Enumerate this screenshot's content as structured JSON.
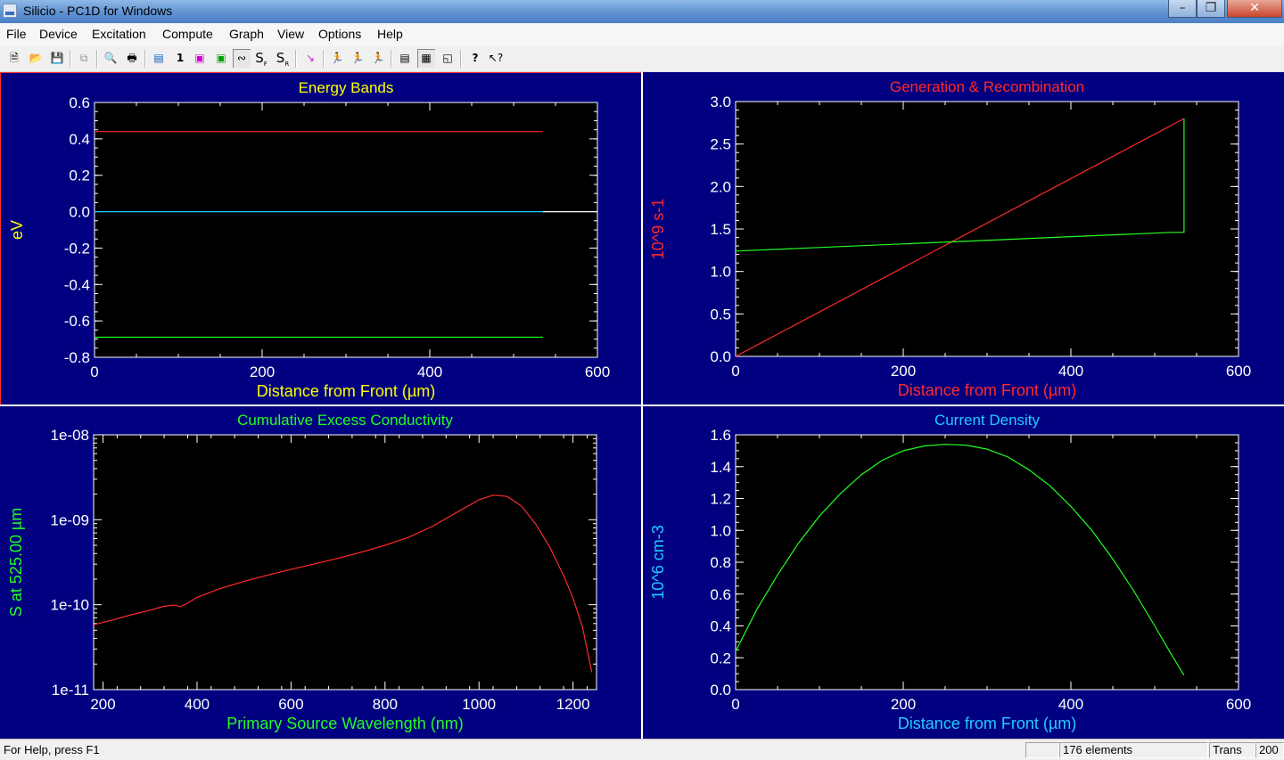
{
  "window": {
    "title": "Silicio - PC1D for Windows"
  },
  "menu": [
    "File",
    "Device",
    "Excitation",
    "Compute",
    "Graph",
    "View",
    "Options",
    "Help"
  ],
  "toolbar": {
    "sf_label": "S",
    "sf_sub": "F",
    "sr_label": "S",
    "sr_sub": "R",
    "one_label": "1",
    "help_label": "?"
  },
  "status": {
    "help_text": "For Help, press F1",
    "elements": "176 elements",
    "mode": "Trans",
    "value": "200"
  },
  "colors": {
    "panel_bg": "#000080",
    "plot_bg": "#000000",
    "yellow": "#ffff00",
    "red": "#ff2a2a",
    "green": "#22ff22",
    "cyan": "#22ccff"
  },
  "panels": [
    {
      "id": "energy-bands",
      "title": "Energy Bands",
      "title_color": "#ffff00",
      "xlabel": "Distance from Front (µm)",
      "xlabel_color": "#ffff00",
      "ylabel": "eV",
      "ylabel_color": "#ffff00",
      "xlim": [
        0,
        600
      ],
      "ylim": [
        -0.8,
        0.6
      ],
      "log": false,
      "xticks": [
        "0",
        "200",
        "400",
        "600"
      ],
      "xtick_values": [
        0,
        200,
        400,
        600
      ],
      "yticks": [
        "0.6",
        "0.4",
        "0.2",
        "0.0",
        "-0.2",
        "-0.4",
        "-0.6",
        "-0.8"
      ],
      "ytick_values": [
        0.6,
        0.4,
        0.2,
        0.0,
        -0.2,
        -0.4,
        -0.6,
        -0.8
      ],
      "xminor": 50,
      "yminor": 0.05,
      "series": [
        {
          "color": "#ff2a2a",
          "points": [
            [
              0,
              0.44
            ],
            [
              535,
              0.44
            ]
          ]
        },
        {
          "color": "#22ccff",
          "points": [
            [
              0,
              0.0
            ],
            [
              535,
              0.0
            ]
          ]
        },
        {
          "color": "#ffffff",
          "points": [
            [
              535,
              0.0
            ],
            [
              600,
              0.0
            ]
          ]
        },
        {
          "color": "#22ff22",
          "points": [
            [
              0,
              -0.69
            ],
            [
              535,
              -0.69
            ]
          ]
        }
      ]
    },
    {
      "id": "generation-recombination",
      "title": "Generation & Recombination",
      "title_color": "#ff2a2a",
      "xlabel": "Distance from Front (µm)",
      "xlabel_color": "#ff2a2a",
      "ylabel": "10^9  s-1",
      "ylabel_color": "#ff2a2a",
      "xlim": [
        0,
        600
      ],
      "ylim": [
        0,
        3.0
      ],
      "log": false,
      "xticks": [
        "0",
        "200",
        "400",
        "600"
      ],
      "xtick_values": [
        0,
        200,
        400,
        600
      ],
      "yticks": [
        "3.0",
        "2.5",
        "2.0",
        "1.5",
        "1.0",
        "0.5",
        "0.0"
      ],
      "ytick_values": [
        3.0,
        2.5,
        2.0,
        1.5,
        1.0,
        0.5,
        0.0
      ],
      "xminor": 50,
      "yminor": 0.1,
      "series": [
        {
          "color": "#ff2a2a",
          "points": [
            [
              0,
              0.0
            ],
            [
              535,
              2.8
            ]
          ]
        },
        {
          "color": "#22ff22",
          "points": [
            [
              0,
              1.24
            ],
            [
              520,
              1.46
            ],
            [
              535,
              1.46
            ],
            [
              535,
              2.8
            ]
          ]
        }
      ]
    },
    {
      "id": "cumulative-excess-conductivity",
      "title": "Cumulative Excess Conductivity",
      "title_color": "#22ff22",
      "xlabel": "Primary Source Wavelength (nm)",
      "xlabel_color": "#22ff22",
      "ylabel": "S at 525.00 µm",
      "ylabel_color": "#22ff22",
      "xlim": [
        180,
        1250
      ],
      "ylim": [
        1e-11,
        1e-08
      ],
      "log": true,
      "xticks": [
        "200",
        "400",
        "600",
        "800",
        "1000",
        "1200"
      ],
      "xtick_values": [
        200,
        400,
        600,
        800,
        1000,
        1200
      ],
      "yticks": [
        "1e-08",
        "1e-09",
        "1e-10",
        "1e-11"
      ],
      "ytick_values": [
        1e-08,
        1e-09,
        1e-10,
        1e-11
      ],
      "xminor": 50,
      "yminor": 0,
      "series": [
        {
          "color": "#ff2a2a",
          "points": [
            [
              180,
              5.8e-11
            ],
            [
              220,
              6.6e-11
            ],
            [
              260,
              7.6e-11
            ],
            [
              300,
              8.6e-11
            ],
            [
              330,
              9.6e-11
            ],
            [
              350,
              9.9e-11
            ],
            [
              365,
              9.5e-11
            ],
            [
              380,
              1.04e-10
            ],
            [
              400,
              1.22e-10
            ],
            [
              450,
              1.55e-10
            ],
            [
              500,
              1.88e-10
            ],
            [
              550,
              2.22e-10
            ],
            [
              600,
              2.6e-10
            ],
            [
              650,
              3.02e-10
            ],
            [
              700,
              3.52e-10
            ],
            [
              750,
              4.15e-10
            ],
            [
              800,
              5e-10
            ],
            [
              850,
              6.2e-10
            ],
            [
              900,
              8.3e-10
            ],
            [
              950,
              1.2e-09
            ],
            [
              1000,
              1.72e-09
            ],
            [
              1030,
              1.95e-09
            ],
            [
              1060,
              1.88e-09
            ],
            [
              1090,
              1.45e-09
            ],
            [
              1120,
              9e-10
            ],
            [
              1150,
              4.8e-10
            ],
            [
              1180,
              2.2e-10
            ],
            [
              1200,
              1.2e-10
            ],
            [
              1220,
              5.5e-11
            ],
            [
              1240,
              1.6e-11
            ]
          ]
        }
      ]
    },
    {
      "id": "current-density",
      "title": "Current Density",
      "title_color": "#22ccff",
      "xlabel": "Distance from Front (µm)",
      "xlabel_color": "#22ccff",
      "ylabel": "10^6  cm-3",
      "ylabel_color": "#22ccff",
      "xlim": [
        0,
        600
      ],
      "ylim": [
        0,
        1.6
      ],
      "log": false,
      "xticks": [
        "0",
        "200",
        "400",
        "600"
      ],
      "xtick_values": [
        0,
        200,
        400,
        600
      ],
      "yticks": [
        "1.6",
        "1.4",
        "1.2",
        "1.0",
        "0.8",
        "0.6",
        "0.4",
        "0.2",
        "0.0"
      ],
      "ytick_values": [
        1.6,
        1.4,
        1.2,
        1.0,
        0.8,
        0.6,
        0.4,
        0.2,
        0.0
      ],
      "xminor": 50,
      "yminor": 0.05,
      "series": [
        {
          "color": "#22ff22",
          "points": [
            [
              0,
              0.24
            ],
            [
              25,
              0.5
            ],
            [
              50,
              0.72
            ],
            [
              75,
              0.92
            ],
            [
              100,
              1.09
            ],
            [
              125,
              1.23
            ],
            [
              150,
              1.35
            ],
            [
              175,
              1.44
            ],
            [
              200,
              1.5
            ],
            [
              225,
              1.53
            ],
            [
              250,
              1.54
            ],
            [
              275,
              1.535
            ],
            [
              300,
              1.51
            ],
            [
              325,
              1.46
            ],
            [
              350,
              1.38
            ],
            [
              375,
              1.28
            ],
            [
              400,
              1.15
            ],
            [
              425,
              1.0
            ],
            [
              450,
              0.82
            ],
            [
              475,
              0.62
            ],
            [
              500,
              0.4
            ],
            [
              520,
              0.22
            ],
            [
              535,
              0.09
            ]
          ]
        }
      ]
    }
  ]
}
